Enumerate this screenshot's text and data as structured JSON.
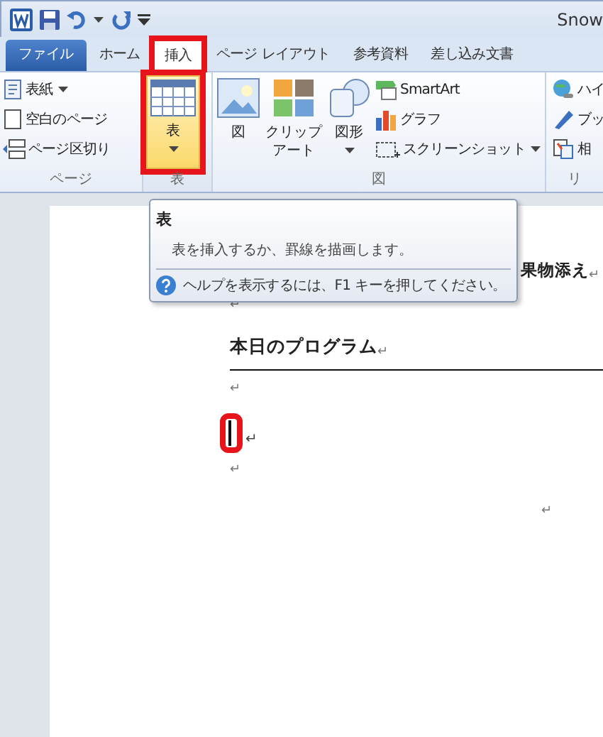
{
  "window": {
    "title": "Snow"
  },
  "tabs": [
    {
      "label": "ファイル",
      "kind": "file",
      "selected": false,
      "highlighted": false
    },
    {
      "label": "ホーム",
      "kind": "normal",
      "selected": false,
      "highlighted": false
    },
    {
      "label": "挿入",
      "kind": "normal",
      "selected": true,
      "highlighted": true
    },
    {
      "label": "ページ レイアウト",
      "kind": "normal",
      "selected": false,
      "highlighted": false
    },
    {
      "label": "参考資料",
      "kind": "normal",
      "selected": false,
      "highlighted": false
    },
    {
      "label": "差し込み文書",
      "kind": "normal",
      "selected": false,
      "highlighted": false
    }
  ],
  "ribbon": {
    "groups": [
      {
        "label": "ページ",
        "items": [
          {
            "kind": "small",
            "label": "表紙",
            "dropdown": true
          },
          {
            "kind": "small",
            "label": "空白のページ",
            "dropdown": false
          },
          {
            "kind": "small",
            "label": "ページ区切り",
            "dropdown": false
          }
        ]
      },
      {
        "label": "表",
        "items": [
          {
            "kind": "large",
            "label": "表",
            "dropdown": true,
            "hovered": true,
            "highlighted": true
          }
        ]
      },
      {
        "label": "図",
        "items": [
          {
            "kind": "large",
            "label": "図",
            "dropdown": false,
            "hovered": false,
            "highlighted": false
          },
          {
            "kind": "large",
            "label": "クリップアート",
            "dropdown": false,
            "hovered": false,
            "highlighted": false
          },
          {
            "kind": "large",
            "label": "図形",
            "dropdown": true,
            "hovered": false,
            "highlighted": false
          },
          {
            "kind": "small",
            "label": "SmartArt",
            "dropdown": false
          },
          {
            "kind": "small",
            "label": "グラフ",
            "dropdown": false
          },
          {
            "kind": "small",
            "label": "スクリーンショット",
            "dropdown": true
          }
        ]
      },
      {
        "label": "リ",
        "items": [
          {
            "kind": "small",
            "label": "ハイ",
            "dropdown": false
          },
          {
            "kind": "small",
            "label": "ブッ",
            "dropdown": false
          },
          {
            "kind": "small",
            "label": "相",
            "dropdown": false
          }
        ]
      }
    ]
  },
  "tooltip": {
    "title": "表",
    "description": "表を挿入するか、罫線を描画します。",
    "help": "ヘルプを表示するには、F1 キーを押してください。"
  },
  "document": {
    "paragraphs": [
      {
        "kind": "text",
        "text": "果物添え",
        "mark": "↵"
      },
      {
        "kind": "empty",
        "mark": "↵"
      },
      {
        "kind": "heading",
        "text": "本日のプログラム",
        "mark": "↵"
      },
      {
        "kind": "empty",
        "mark": "↵"
      },
      {
        "kind": "cursor",
        "mark": "↵",
        "highlighted": true
      },
      {
        "kind": "empty",
        "mark": "↵"
      },
      {
        "kind": "right",
        "mark": "↵"
      }
    ]
  }
}
